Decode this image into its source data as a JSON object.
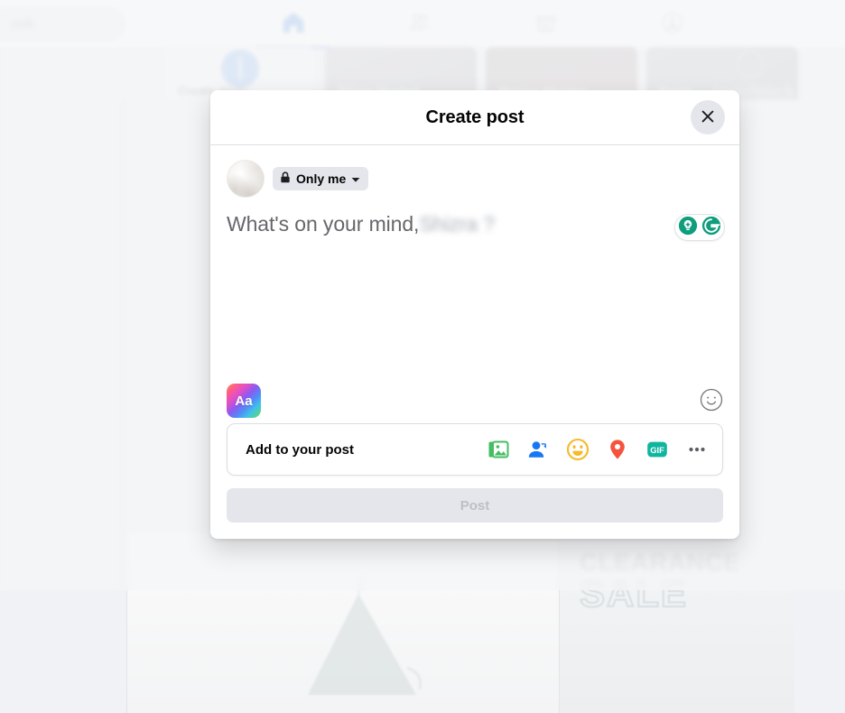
{
  "background": {
    "search_placeholder_tail": "ook",
    "nav_items": [
      {
        "name": "home",
        "label": "Home",
        "active": true
      },
      {
        "name": "friends",
        "label": "Friends",
        "active": false
      },
      {
        "name": "marketplace",
        "label": "Marketplace",
        "active": false
      },
      {
        "name": "groups",
        "label": "Groups",
        "active": false
      }
    ],
    "stories": [
      {
        "label": "Create story",
        "type": "create"
      },
      {
        "label": "Shizra Mughal",
        "type": "story"
      },
      {
        "label": "Monica Sharma",
        "type": "story"
      },
      {
        "label": "Portia",
        "type": "story",
        "watermark": "HemStitch"
      }
    ],
    "ad": {
      "line1": "CLEARANCE",
      "line2": "SALE"
    }
  },
  "modal": {
    "title": "Create post",
    "close_label": "Close",
    "author": {
      "avatar_alt": "Profile photo",
      "privacy": {
        "label": "Only me",
        "icon": "lock-icon",
        "caret": "chevron-down-icon"
      }
    },
    "composer": {
      "placeholder_prefix": "What's on your mind,",
      "placeholder_name_redacted": "Shizra ?",
      "grammarly": {
        "name": "grammarly-widget",
        "suggestion_icon": "lightbulb-icon",
        "logo_icon": "grammarly-logo-icon",
        "color": "#15c39a"
      }
    },
    "tools": {
      "background_color_label": "Aa",
      "background_color_name": "background-color-picker",
      "emoji_name": "emoji-picker"
    },
    "add_to_post": {
      "label": "Add to your post",
      "icons": [
        {
          "name": "photo-video-icon",
          "label": "Photo/video",
          "color": "#45bd62"
        },
        {
          "name": "tag-people-icon",
          "label": "Tag people",
          "color": "#1877f2"
        },
        {
          "name": "feeling-icon",
          "label": "Feeling/activity",
          "color": "#f7b928"
        },
        {
          "name": "check-in-icon",
          "label": "Check in",
          "color": "#f5533d"
        },
        {
          "name": "gif-icon",
          "label": "GIF",
          "color": "#10b5a0"
        },
        {
          "name": "more-options-icon",
          "label": "More",
          "color": "#606770"
        }
      ]
    },
    "post_button": {
      "label": "Post",
      "disabled": true
    }
  }
}
